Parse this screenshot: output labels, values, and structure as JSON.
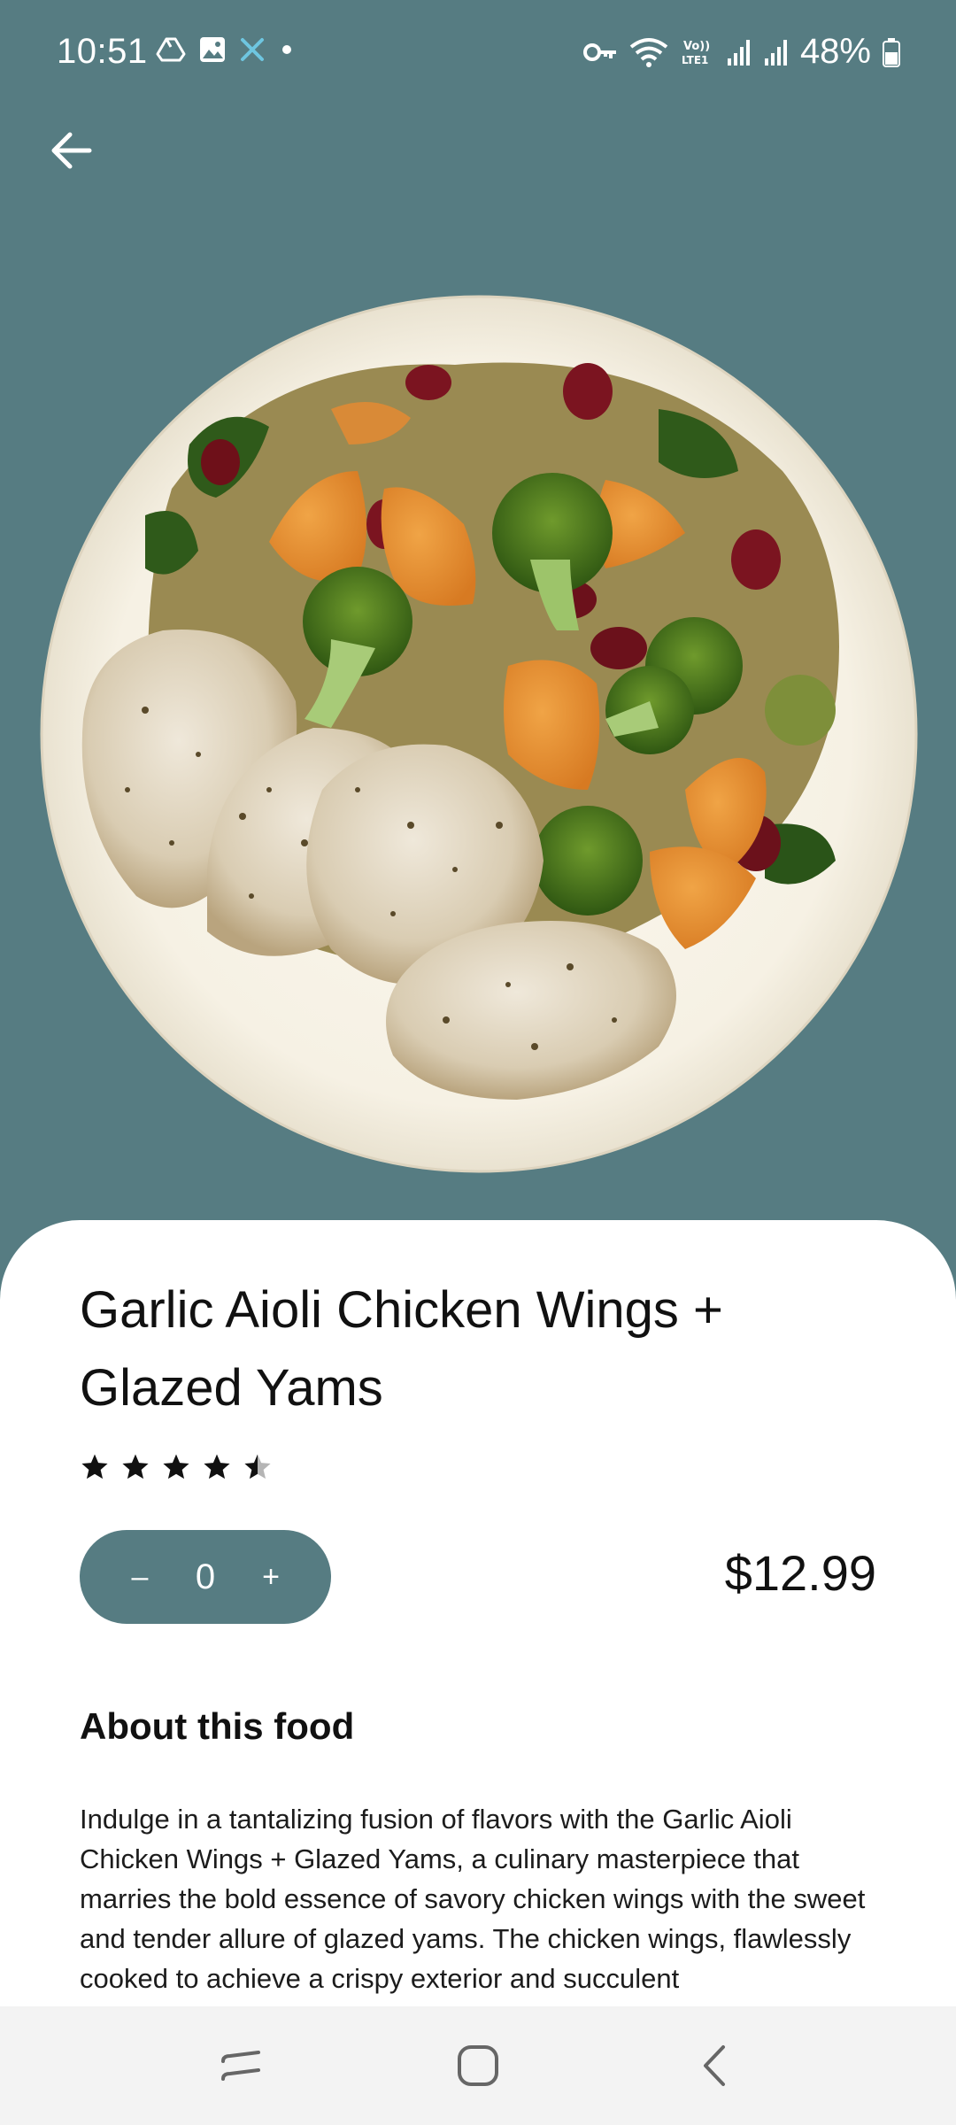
{
  "status": {
    "time": "10:51",
    "battery": "48%",
    "volte": "Vo)) LTE1"
  },
  "colors": {
    "header_bg": "#567c82",
    "stepper_bg": "#567c82",
    "sheet_bg": "#ffffff"
  },
  "product": {
    "title": "Garlic Aioli Chicken Wings + Glazed Yams",
    "rating": 4.5,
    "quantity": "0",
    "decrement_label": "–",
    "increment_label": "+",
    "price": "$12.99"
  },
  "about": {
    "heading": "About this food",
    "text": "Indulge in a tantalizing fusion of flavors with the Garlic Aioli Chicken Wings + Glazed Yams, a culinary masterpiece that marries the bold essence of savory chicken wings with the sweet and tender allure of glazed yams. The chicken wings, flawlessly cooked to achieve a crispy exterior and succulent"
  },
  "icons": {
    "back": "arrow-left-icon",
    "nav_recent": "recent-apps-icon",
    "nav_home": "home-icon",
    "nav_back": "nav-back-icon"
  }
}
